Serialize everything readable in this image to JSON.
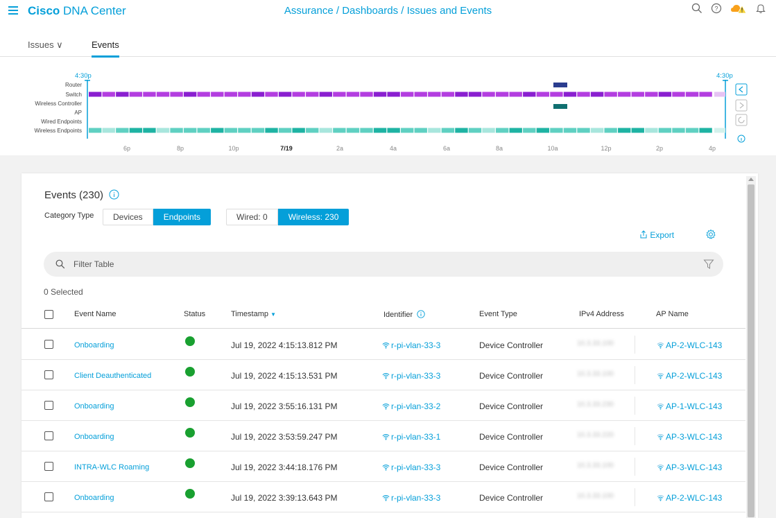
{
  "header": {
    "brand_bold": "Cisco",
    "brand_rest": " DNA Center",
    "breadcrumb": "Assurance / Dashboards / Issues and Events",
    "icons": [
      "search-icon",
      "help-icon",
      "cloud-warning-icon",
      "bell-icon"
    ]
  },
  "tabs": [
    {
      "label": "Issues ∨"
    },
    {
      "label": "Events"
    }
  ],
  "timeline": {
    "start_label": "4:30p",
    "end_label": "4:30p",
    "rows": [
      "Router",
      "Switch",
      "Wireless Controller",
      "AP",
      "Wired Endpoints",
      "Wireless Endpoints"
    ],
    "ticks": [
      "6p",
      "8p",
      "10p",
      "7/19",
      "2a",
      "4a",
      "6a",
      "8a",
      "10a",
      "12p",
      "2p",
      "4p"
    ],
    "colors": {
      "switch": "#b33ee0",
      "switch_dark": "#8a1fd0",
      "wireless": "#5fd0c2",
      "wireless_dark": "#1eb3a3",
      "router": "#2b3d8f",
      "ap": "#0f6f70",
      "cursor": "#049fd9"
    }
  },
  "events": {
    "title": "Events (230)",
    "category_label": "Category Type",
    "category_buttons": [
      "Devices",
      "Endpoints"
    ],
    "conn_buttons": [
      "Wired: 0",
      "Wireless: 230"
    ],
    "export_label": "Export",
    "filter_placeholder": "Filter Table",
    "selected": "0 Selected",
    "columns": [
      "Event Name",
      "Status",
      "Timestamp",
      "Identifier",
      "Event Type",
      "IPv4 Address",
      "AP Name"
    ],
    "rows": [
      {
        "name": "Onboarding",
        "time": "Jul 19, 2022 4:15:13.812 PM",
        "id": "r-pi-vlan-33-3",
        "type": "Device Controller",
        "ip": "10.3.33.100",
        "ap": "AP-2-WLC-143"
      },
      {
        "name": "Client Deauthenticated",
        "time": "Jul 19, 2022 4:15:13.531 PM",
        "id": "r-pi-vlan-33-3",
        "type": "Device Controller",
        "ip": "10.3.33.100",
        "ap": "AP-2-WLC-143"
      },
      {
        "name": "Onboarding",
        "time": "Jul 19, 2022 3:55:16.131 PM",
        "id": "r-pi-vlan-33-2",
        "type": "Device Controller",
        "ip": "10.3.33.230",
        "ap": "AP-1-WLC-143"
      },
      {
        "name": "Onboarding",
        "time": "Jul 19, 2022 3:53:59.247 PM",
        "id": "r-pi-vlan-33-1",
        "type": "Device Controller",
        "ip": "10.3.33.220",
        "ap": "AP-3-WLC-143"
      },
      {
        "name": "INTRA-WLC Roaming",
        "time": "Jul 19, 2022 3:44:18.176 PM",
        "id": "r-pi-vlan-33-3",
        "type": "Device Controller",
        "ip": "10.3.33.100",
        "ap": "AP-3-WLC-143"
      },
      {
        "name": "Onboarding",
        "time": "Jul 19, 2022 3:39:13.643 PM",
        "id": "r-pi-vlan-33-3",
        "type": "Device Controller",
        "ip": "10.3.33.100",
        "ap": "AP-2-WLC-143"
      }
    ]
  }
}
